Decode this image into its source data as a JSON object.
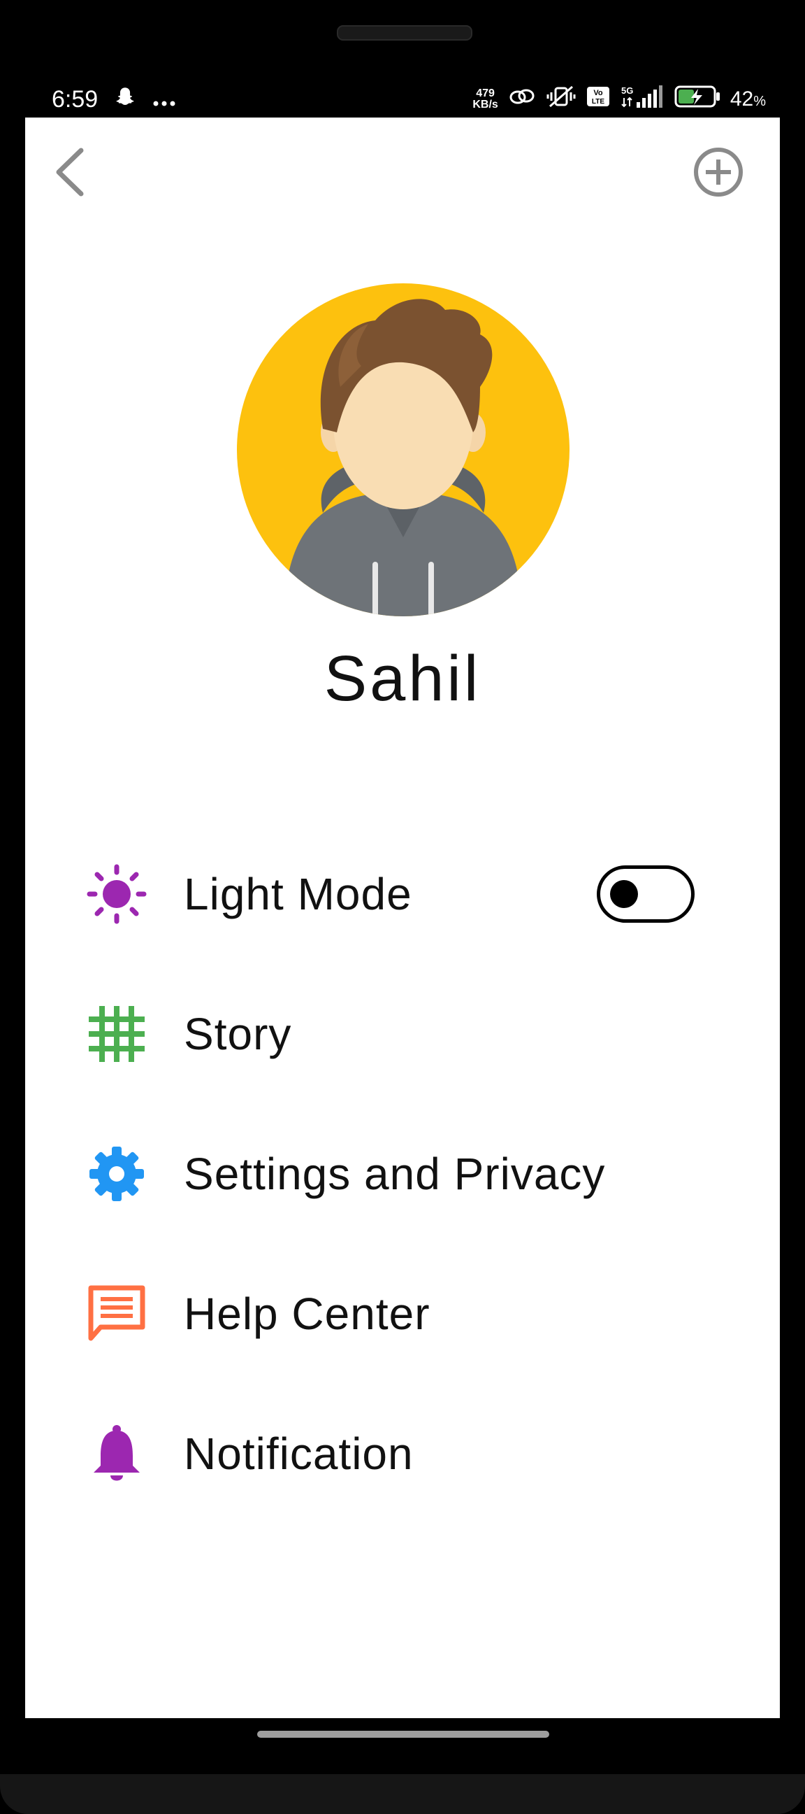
{
  "status_bar": {
    "time": "6:59",
    "speed_value": "479",
    "speed_unit": "KB/s",
    "network": "5G",
    "volte": "Vo LTE",
    "battery_percent": "42",
    "battery_suffix": "%",
    "icons": [
      "snapchat-icon",
      "more-dots-icon",
      "link-icon",
      "vibrate-mute-icon",
      "volte-icon",
      "signal-icon",
      "battery-charging-icon"
    ]
  },
  "topbar": {
    "back_icon": "chevron-left-icon",
    "add_icon": "plus-circle-icon"
  },
  "profile": {
    "name": "Sahil",
    "avatar_bg_color": "#FDC10E"
  },
  "menu": {
    "items": [
      {
        "label": "Light Mode",
        "icon": "sun-icon",
        "icon_color": "#9C27B0",
        "has_toggle": true,
        "toggle_on": false
      },
      {
        "label": "Story",
        "icon": "grid-icon",
        "icon_color": "#4CAF50"
      },
      {
        "label": "Settings and Privacy",
        "icon": "gear-icon",
        "icon_color": "#2196F3"
      },
      {
        "label": "Help Center",
        "icon": "chat-icon",
        "icon_color": "#FF7043"
      },
      {
        "label": "Notification",
        "icon": "bell-icon",
        "icon_color": "#9C27B0"
      }
    ]
  }
}
